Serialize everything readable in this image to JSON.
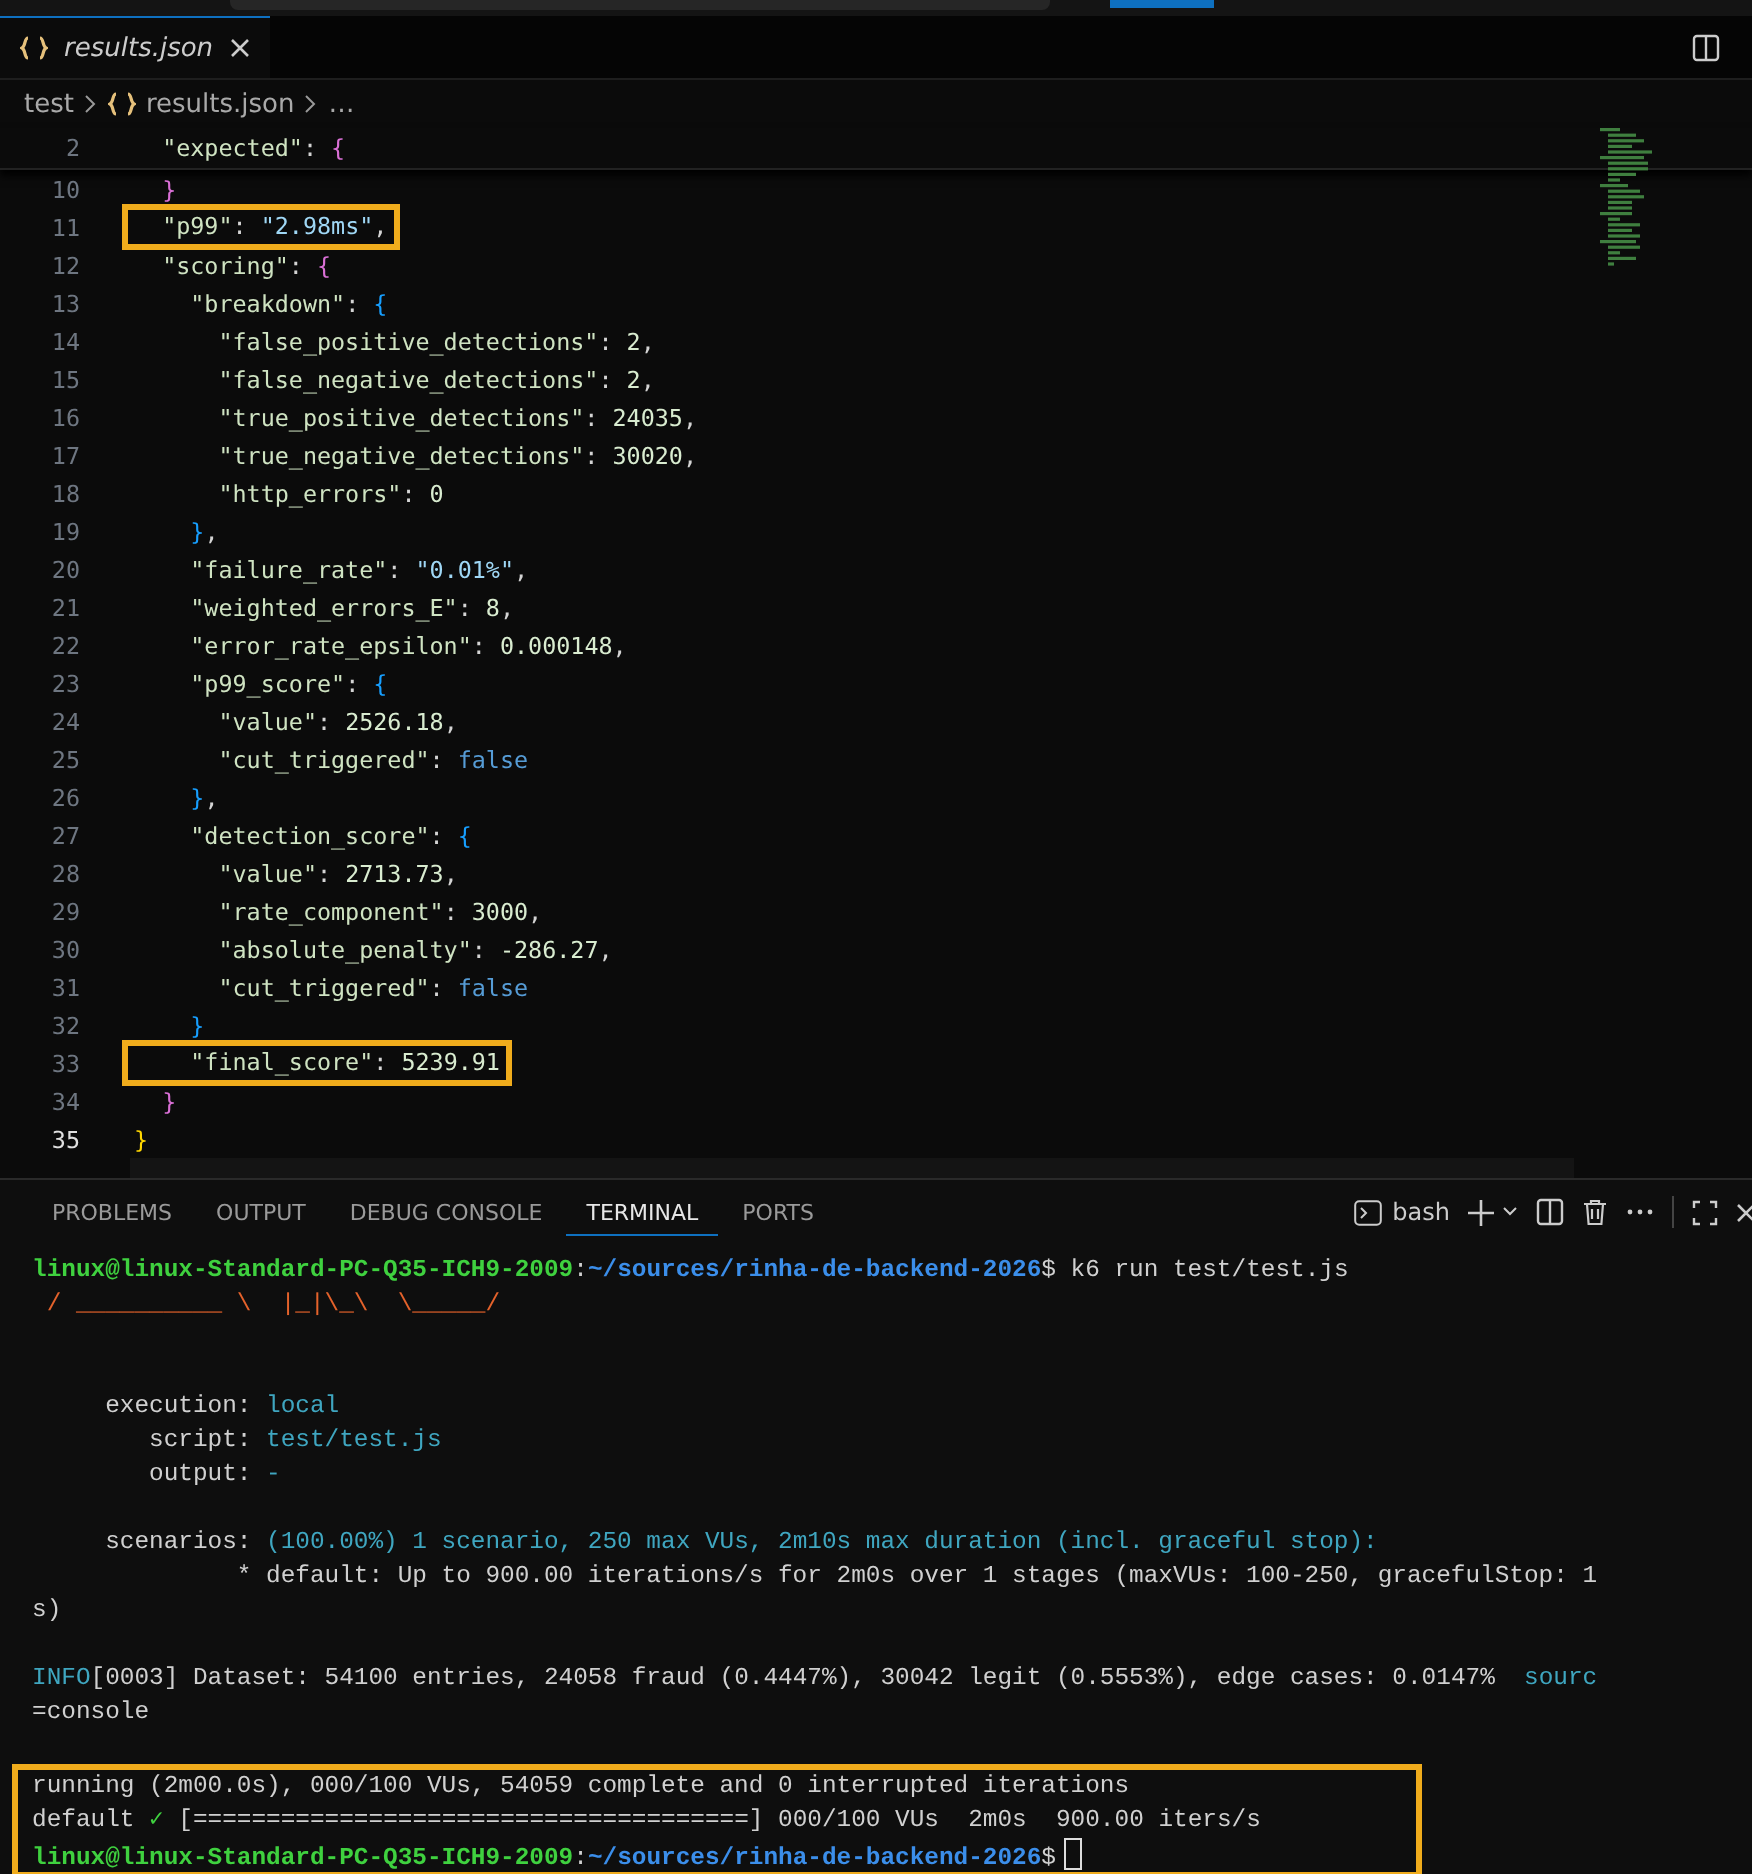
{
  "editor_tab": {
    "label": "results.json",
    "selected": true
  },
  "breadcrumb": [
    "test",
    "results.json",
    "…"
  ],
  "editor": {
    "sticky_line": {
      "number": "2",
      "tokens": [
        {
          "kind": "key",
          "text": "  \"expected\""
        },
        {
          "kind": "punct",
          "text": ": "
        },
        {
          "kind": "brace",
          "text": "{",
          "color": "#da70d6"
        }
      ]
    },
    "lines": [
      {
        "number": "10",
        "highlighted": false,
        "current": false,
        "tokens": [
          {
            "kind": "brace",
            "text": "  }",
            "color": "#da70d6"
          }
        ]
      },
      {
        "number": "11",
        "highlighted": true,
        "current": false,
        "tokens": [
          {
            "kind": "key",
            "text": "  \"p99\""
          },
          {
            "kind": "punct",
            "text": ": "
          },
          {
            "kind": "string",
            "text": "\"2.98ms\""
          },
          {
            "kind": "punct",
            "text": ","
          }
        ]
      },
      {
        "number": "12",
        "highlighted": false,
        "current": false,
        "tokens": [
          {
            "kind": "key",
            "text": "  \"scoring\""
          },
          {
            "kind": "punct",
            "text": ": "
          },
          {
            "kind": "brace",
            "text": "{",
            "color": "#da70d6"
          }
        ]
      },
      {
        "number": "13",
        "highlighted": false,
        "current": false,
        "tokens": [
          {
            "kind": "key",
            "text": "    \"breakdown\""
          },
          {
            "kind": "punct",
            "text": ": "
          },
          {
            "kind": "brace",
            "text": "{",
            "color": "#179fff"
          }
        ]
      },
      {
        "number": "14",
        "highlighted": false,
        "current": false,
        "tokens": [
          {
            "kind": "key",
            "text": "      \"false_positive_detections\""
          },
          {
            "kind": "punct",
            "text": ": "
          },
          {
            "kind": "number",
            "text": "2"
          },
          {
            "kind": "punct",
            "text": ","
          }
        ]
      },
      {
        "number": "15",
        "highlighted": false,
        "current": false,
        "tokens": [
          {
            "kind": "key",
            "text": "      \"false_negative_detections\""
          },
          {
            "kind": "punct",
            "text": ": "
          },
          {
            "kind": "number",
            "text": "2"
          },
          {
            "kind": "punct",
            "text": ","
          }
        ]
      },
      {
        "number": "16",
        "highlighted": false,
        "current": false,
        "tokens": [
          {
            "kind": "key",
            "text": "      \"true_positive_detections\""
          },
          {
            "kind": "punct",
            "text": ": "
          },
          {
            "kind": "number",
            "text": "24035"
          },
          {
            "kind": "punct",
            "text": ","
          }
        ]
      },
      {
        "number": "17",
        "highlighted": false,
        "current": false,
        "tokens": [
          {
            "kind": "key",
            "text": "      \"true_negative_detections\""
          },
          {
            "kind": "punct",
            "text": ": "
          },
          {
            "kind": "number",
            "text": "30020"
          },
          {
            "kind": "punct",
            "text": ","
          }
        ]
      },
      {
        "number": "18",
        "highlighted": false,
        "current": false,
        "tokens": [
          {
            "kind": "key",
            "text": "      \"http_errors\""
          },
          {
            "kind": "punct",
            "text": ": "
          },
          {
            "kind": "number",
            "text": "0"
          }
        ]
      },
      {
        "number": "19",
        "highlighted": false,
        "current": false,
        "tokens": [
          {
            "kind": "brace",
            "text": "    }",
            "color": "#179fff"
          },
          {
            "kind": "punct",
            "text": ","
          }
        ]
      },
      {
        "number": "20",
        "highlighted": false,
        "current": false,
        "tokens": [
          {
            "kind": "key",
            "text": "    \"failure_rate\""
          },
          {
            "kind": "punct",
            "text": ": "
          },
          {
            "kind": "string",
            "text": "\"0.01%\""
          },
          {
            "kind": "punct",
            "text": ","
          }
        ]
      },
      {
        "number": "21",
        "highlighted": false,
        "current": false,
        "tokens": [
          {
            "kind": "key",
            "text": "    \"weighted_errors_E\""
          },
          {
            "kind": "punct",
            "text": ": "
          },
          {
            "kind": "number",
            "text": "8"
          },
          {
            "kind": "punct",
            "text": ","
          }
        ]
      },
      {
        "number": "22",
        "highlighted": false,
        "current": false,
        "tokens": [
          {
            "kind": "key",
            "text": "    \"error_rate_epsilon\""
          },
          {
            "kind": "punct",
            "text": ": "
          },
          {
            "kind": "number",
            "text": "0.000148"
          },
          {
            "kind": "punct",
            "text": ","
          }
        ]
      },
      {
        "number": "23",
        "highlighted": false,
        "current": false,
        "tokens": [
          {
            "kind": "key",
            "text": "    \"p99_score\""
          },
          {
            "kind": "punct",
            "text": ": "
          },
          {
            "kind": "brace",
            "text": "{",
            "color": "#179fff"
          }
        ]
      },
      {
        "number": "24",
        "highlighted": false,
        "current": false,
        "tokens": [
          {
            "kind": "key",
            "text": "      \"value\""
          },
          {
            "kind": "punct",
            "text": ": "
          },
          {
            "kind": "number",
            "text": "2526.18"
          },
          {
            "kind": "punct",
            "text": ","
          }
        ]
      },
      {
        "number": "25",
        "highlighted": false,
        "current": false,
        "tokens": [
          {
            "kind": "key",
            "text": "      \"cut_triggered\""
          },
          {
            "kind": "punct",
            "text": ": "
          },
          {
            "kind": "boolean",
            "text": "false"
          }
        ]
      },
      {
        "number": "26",
        "highlighted": false,
        "current": false,
        "tokens": [
          {
            "kind": "brace",
            "text": "    }",
            "color": "#179fff"
          },
          {
            "kind": "punct",
            "text": ","
          }
        ]
      },
      {
        "number": "27",
        "highlighted": false,
        "current": false,
        "tokens": [
          {
            "kind": "key",
            "text": "    \"detection_score\""
          },
          {
            "kind": "punct",
            "text": ": "
          },
          {
            "kind": "brace",
            "text": "{",
            "color": "#179fff"
          }
        ]
      },
      {
        "number": "28",
        "highlighted": false,
        "current": false,
        "tokens": [
          {
            "kind": "key",
            "text": "      \"value\""
          },
          {
            "kind": "punct",
            "text": ": "
          },
          {
            "kind": "number",
            "text": "2713.73"
          },
          {
            "kind": "punct",
            "text": ","
          }
        ]
      },
      {
        "number": "29",
        "highlighted": false,
        "current": false,
        "tokens": [
          {
            "kind": "key",
            "text": "      \"rate_component\""
          },
          {
            "kind": "punct",
            "text": ": "
          },
          {
            "kind": "number",
            "text": "3000"
          },
          {
            "kind": "punct",
            "text": ","
          }
        ]
      },
      {
        "number": "30",
        "highlighted": false,
        "current": false,
        "tokens": [
          {
            "kind": "key",
            "text": "      \"absolute_penalty\""
          },
          {
            "kind": "punct",
            "text": ": "
          },
          {
            "kind": "number",
            "text": "-286.27"
          },
          {
            "kind": "punct",
            "text": ","
          }
        ]
      },
      {
        "number": "31",
        "highlighted": false,
        "current": false,
        "tokens": [
          {
            "kind": "key",
            "text": "      \"cut_triggered\""
          },
          {
            "kind": "punct",
            "text": ": "
          },
          {
            "kind": "boolean",
            "text": "false"
          }
        ]
      },
      {
        "number": "32",
        "highlighted": false,
        "current": false,
        "tokens": [
          {
            "kind": "brace",
            "text": "    }",
            "color": "#179fff"
          }
        ]
      },
      {
        "number": "33",
        "highlighted": true,
        "current": false,
        "tokens": [
          {
            "kind": "key",
            "text": "    \"final_score\""
          },
          {
            "kind": "punct",
            "text": ": "
          },
          {
            "kind": "number",
            "text": "5239.91"
          }
        ]
      },
      {
        "number": "34",
        "highlighted": false,
        "current": false,
        "tokens": [
          {
            "kind": "brace",
            "text": "  }",
            "color": "#da70d6"
          }
        ]
      },
      {
        "number": "35",
        "highlighted": false,
        "current": true,
        "tokens": [
          {
            "kind": "brace",
            "text": "}",
            "color": "#ffd700"
          }
        ]
      }
    ]
  },
  "panel_tabs": [
    {
      "label": "PROBLEMS",
      "selected": false
    },
    {
      "label": "OUTPUT",
      "selected": false
    },
    {
      "label": "DEBUG CONSOLE",
      "selected": false
    },
    {
      "label": "TERMINAL",
      "selected": true
    },
    {
      "label": "PORTS",
      "selected": false
    }
  ],
  "terminal_name": "bash",
  "terminal": [
    {
      "kind": "text",
      "highlighted": false,
      "tokens": [
        {
          "kind": "user",
          "text": "linux@linux-Standard-PC-Q35-ICH9-2009"
        },
        {
          "kind": "plain",
          "text": ":"
        },
        {
          "kind": "path",
          "text": "~/sources/rinha-de-backend-2026"
        },
        {
          "kind": "plain",
          "text": "$ k6 run test/test.js"
        }
      ]
    },
    {
      "kind": "text",
      "highlighted": false,
      "tokens": [
        {
          "kind": "art",
          "text": " / __________ \\  |_|\\_\\  \\_____/"
        }
      ]
    },
    {
      "kind": "blank"
    },
    {
      "kind": "blank"
    },
    {
      "kind": "text",
      "highlighted": false,
      "tokens": [
        {
          "kind": "plain",
          "text": "     execution: "
        },
        {
          "kind": "value",
          "text": "local"
        }
      ]
    },
    {
      "kind": "text",
      "highlighted": false,
      "tokens": [
        {
          "kind": "plain",
          "text": "        script: "
        },
        {
          "kind": "value",
          "text": "test/test.js"
        }
      ]
    },
    {
      "kind": "text",
      "highlighted": false,
      "tokens": [
        {
          "kind": "plain",
          "text": "        output: "
        },
        {
          "kind": "value",
          "text": "-"
        }
      ]
    },
    {
      "kind": "blank"
    },
    {
      "kind": "text",
      "highlighted": false,
      "tokens": [
        {
          "kind": "plain",
          "text": "     scenarios: "
        },
        {
          "kind": "value",
          "text": "(100.00%) 1 scenario, 250 max VUs, 2m10s max duration (incl. graceful stop):"
        }
      ]
    },
    {
      "kind": "text",
      "highlighted": false,
      "tokens": [
        {
          "kind": "plain",
          "text": "              * default: Up to 900.00 iterations/s for 2m0s over 1 stages (maxVUs: 100-250, gracefulStop: 1"
        }
      ]
    },
    {
      "kind": "text",
      "highlighted": false,
      "tokens": [
        {
          "kind": "plain",
          "text": "s)"
        }
      ]
    },
    {
      "kind": "blank"
    },
    {
      "kind": "text",
      "highlighted": false,
      "tokens": [
        {
          "kind": "value",
          "text": "INFO"
        },
        {
          "kind": "plain",
          "text": "[0003] Dataset: 54100 entries, 24058 fraud (0.4447%), 30042 legit (0.5553%), edge cases: 0.0147%  "
        },
        {
          "kind": "value",
          "text": "sourc"
        }
      ]
    },
    {
      "kind": "text",
      "highlighted": false,
      "tokens": [
        {
          "kind": "plain",
          "text": "=console"
        }
      ]
    },
    {
      "kind": "blank"
    },
    {
      "kind": "text",
      "highlighted": true,
      "tokens": [
        {
          "kind": "plain",
          "text": "running (2m00.0s), 000/100 VUs, 54059 complete and 0 interrupted iterations"
        }
      ]
    },
    {
      "kind": "text",
      "highlighted": true,
      "tokens": [
        {
          "kind": "plain",
          "text": "default "
        },
        {
          "kind": "check",
          "text": "✓"
        },
        {
          "kind": "plain",
          "text": " [======================================] 000/100 VUs  2m0s  900.00 iters/s"
        }
      ]
    },
    {
      "kind": "prompt",
      "highlighted": true,
      "tokens": [
        {
          "kind": "user",
          "text": "linux@linux-Standard-PC-Q35-ICH9-2009"
        },
        {
          "kind": "plain",
          "text": ":"
        },
        {
          "kind": "path",
          "text": "~/sources/rinha-de-backend-2026"
        },
        {
          "kind": "plain",
          "text": "$"
        }
      ]
    }
  ]
}
